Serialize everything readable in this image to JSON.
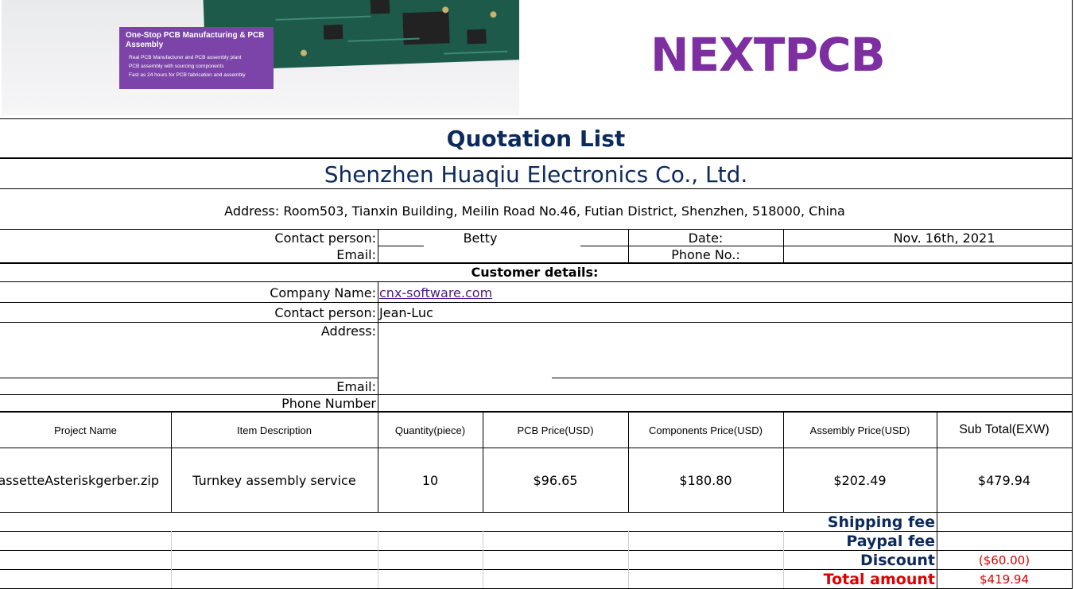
{
  "banner": {
    "promo_title": "One-Stop PCB Manufacturing & PCB Assembly",
    "promo_lines": [
      "Real PCB Manufacturer and PCB assembly plant",
      "PCB assembly with sourcing components",
      "Fast as 24 hours for PCB fabrication and assembly"
    ]
  },
  "logo": {
    "text": "NEXTPCB",
    "color": "#7d2ea0"
  },
  "title": "Quotation List",
  "company": {
    "name": "Shenzhen Huaqiu Electronics Co., Ltd.",
    "address": "Address:  Room503, Tianxin Building, Meilin Road No.46, Futian District, Shenzhen, 518000, China",
    "contact_label": "Contact person:",
    "contact_value": "Betty",
    "email_label": "Email:",
    "date_label": "Date:",
    "date_value": "Nov. 16th, 2021",
    "phone_label": "Phone No.:"
  },
  "customer": {
    "heading": "Customer details:",
    "company_label": "Company Name:",
    "company_value": "cnx-software.com",
    "contact_label": "Contact person:",
    "contact_value": "Jean-Luc",
    "address_label": "Address:",
    "email_label": "Email:",
    "phone_label": "Phone Number"
  },
  "table": {
    "headers": [
      "Project Name",
      "Item Description",
      "Quantity(piece)",
      "PCB Price(USD)",
      "Components Price(USD)",
      "Assembly Price(USD)",
      "Sub Total(EXW)"
    ],
    "row": [
      "XassetteAsteriskgerber.zip",
      "Turnkey assembly service",
      "10",
      "$96.65",
      "$180.80",
      "$202.49",
      "$479.94"
    ]
  },
  "totals": {
    "shipping_label": "Shipping fee",
    "shipping_value": "",
    "paypal_label": "Paypal fee",
    "paypal_value": "",
    "discount_label": "Discount",
    "discount_value": "($60.00)",
    "total_label": "Total amount",
    "total_value": "$419.94"
  },
  "colors": {
    "navy": "#0d2a5c",
    "red": "#e00000",
    "purple": "#7d2ea0"
  }
}
